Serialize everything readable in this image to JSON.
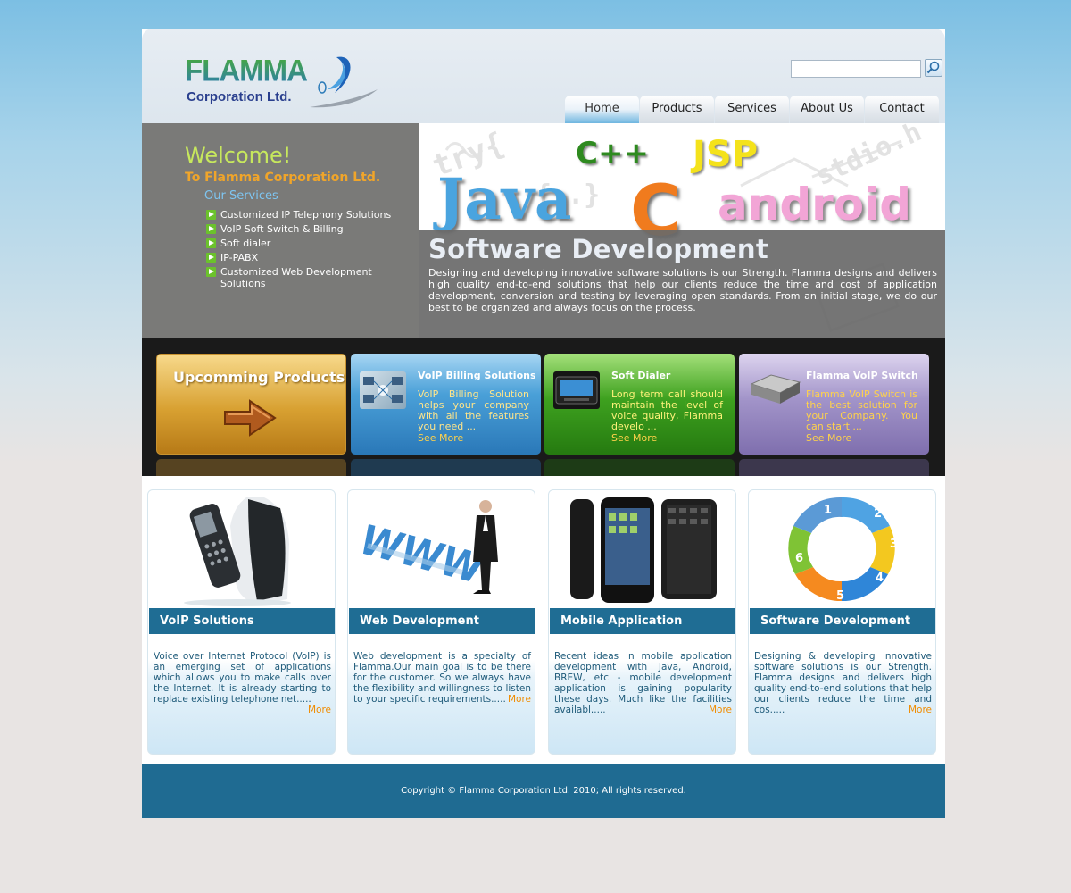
{
  "header": {
    "logo": {
      "name": "FLAMMA",
      "subtitle": "Corporation Ltd."
    },
    "search": {
      "placeholder": "",
      "value": ""
    },
    "nav": [
      "Home",
      "Products",
      "Services",
      "About Us",
      "Contact"
    ],
    "active_nav": "Home"
  },
  "banner": {
    "welcome": "Welcome!",
    "welcome_sub": "To Flamma Corporation Ltd.",
    "services_heading": "Our Services",
    "services": [
      "Customized IP Telephony Solutions",
      "VoIP Soft Switch & Billing",
      "Soft dialer",
      "IP-PABX",
      "Customized Web Development Solutions"
    ],
    "languages": [
      "C++",
      "JSP",
      "Java",
      "C",
      "android"
    ],
    "title": "Software Development",
    "text": "Designing and developing innovative software solutions is our Strength. Flamma designs and delivers high quality end-to-end solutions that help our clients reduce the time and cost of application development, conversion and testing by leveraging open standards. From an initial stage, we do our best to be organized and always focus on the process."
  },
  "products": {
    "upcoming_label": "Upcomming Products",
    "items": [
      {
        "title": "VoIP Billing Solutions",
        "text": "VoIP Billing Solution helps your company with all the features you need ...",
        "more": "See More",
        "color": "#4a9fd6"
      },
      {
        "title": "Soft Dialer",
        "text": "Long term call should maintain the level of voice quality, Flamma develo ...",
        "more": "See More",
        "color": "#3ea11f"
      },
      {
        "title": "Flamma VoIP Switch",
        "text": "Flamma VoIP Switch is the best solution for your Company.  You can start ...",
        "more": "See More",
        "color": "#9a8bbf"
      }
    ]
  },
  "cards": [
    {
      "title": "VoIP Solutions",
      "text": "Voice over Internet Protocol (VoIP) is an emerging set of applications which allows you to make calls over the Internet. It is already starting to replace existing telephone net.....",
      "more": "More"
    },
    {
      "title": "Web Development",
      "text": "Web development is a specialty of Flamma.Our main goal is to be there for the customer. So we always have the flexibility and willingness to listen to your specific requirements.....",
      "more": "More"
    },
    {
      "title": "Mobile Application",
      "text": "Recent ideas in mobile application development with Java, Android, BREW, etc - mobile development application is gaining popularity these days. Much like the facilities availabl.....",
      "more": "More"
    },
    {
      "title": "Software Development",
      "text": "Designing & developing innovative software solutions is our Strength. Flamma designs and delivers high quality end-to-end solutions that help our clients reduce the time and cos.....",
      "more": "More"
    }
  ],
  "cycle_steps": [
    "1",
    "2",
    "3",
    "4",
    "5",
    "6"
  ],
  "footer": {
    "copyright": "Copyright © Flamma Corporation Ltd. 2010; All rights reserved."
  }
}
